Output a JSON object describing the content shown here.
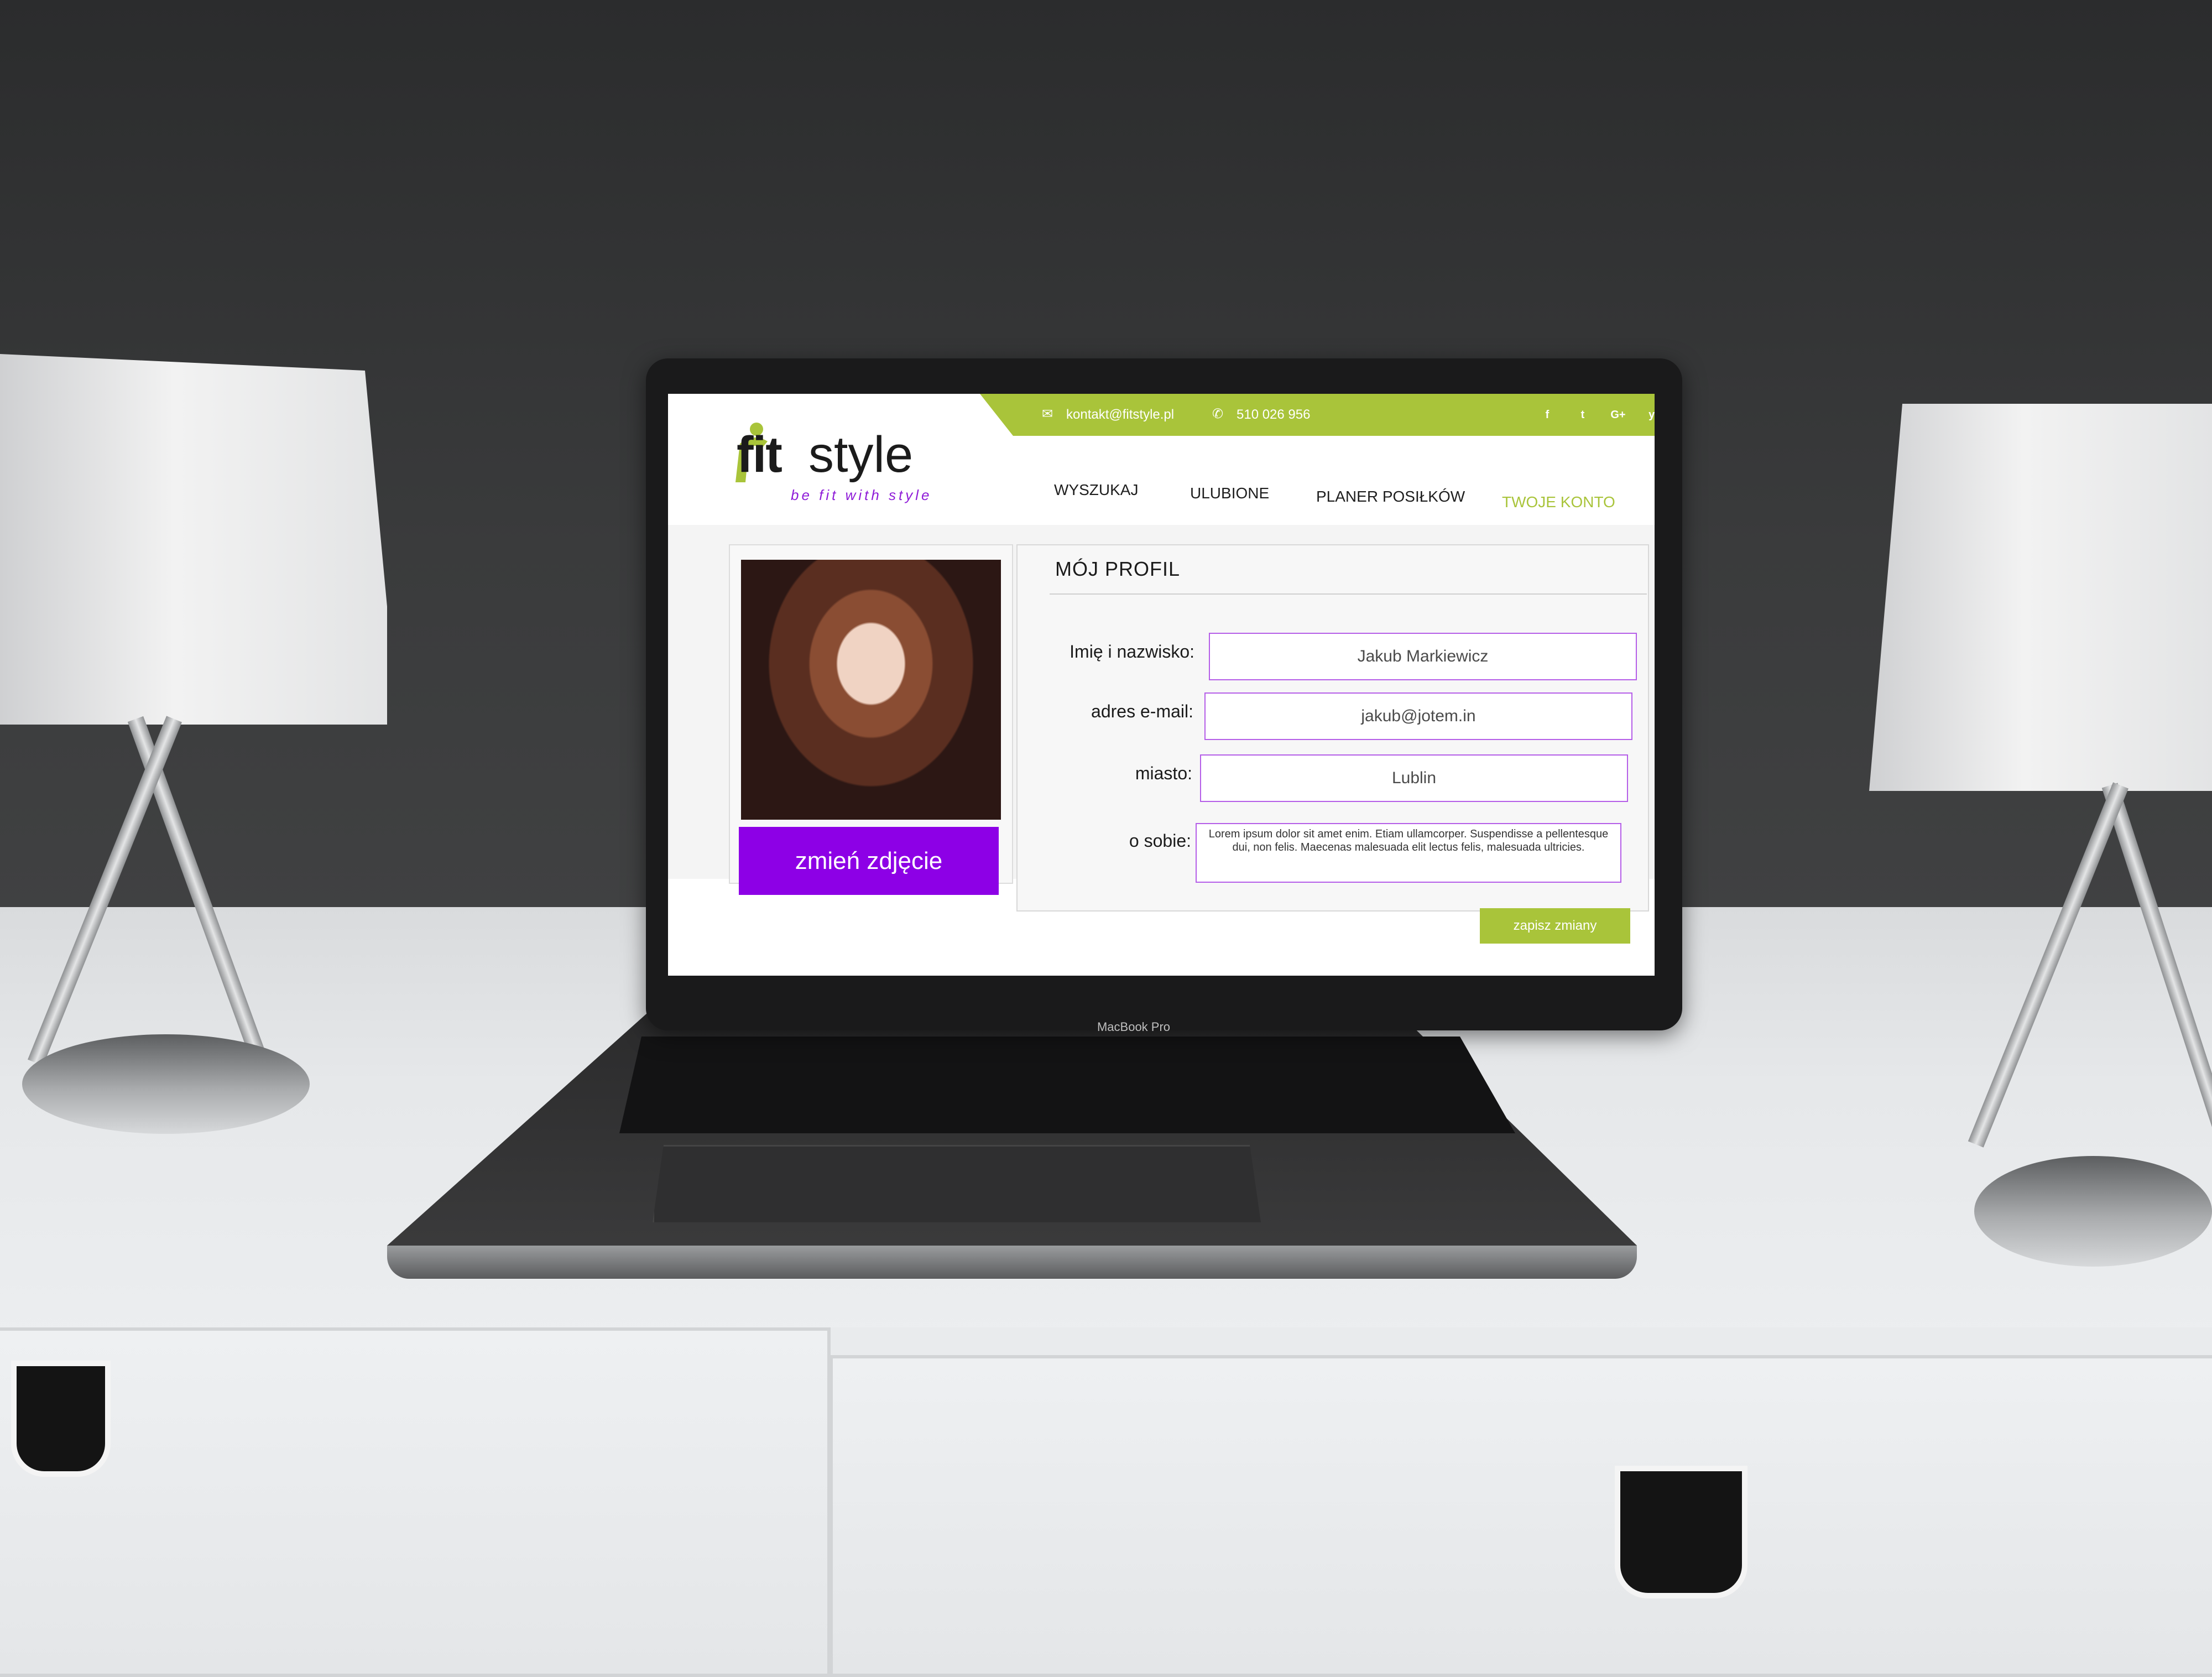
{
  "laptop": {
    "model_label": "MacBook Pro"
  },
  "site": {
    "logo": {
      "fit": "fit",
      "style": "style",
      "tagline": "be fit with style"
    },
    "topbar": {
      "email": "kontakt@fitstyle.pl",
      "phone": "510 026 956",
      "social": [
        "f",
        "t",
        "G+",
        "yt"
      ]
    },
    "nav": {
      "items": [
        {
          "label": "WYSZUKAJ",
          "active": false
        },
        {
          "label": "ULUBIONE",
          "active": false
        },
        {
          "label": "PLANER POSIŁKÓW",
          "active": false
        },
        {
          "label": "TWOJE KONTO",
          "active": true
        }
      ]
    },
    "profile": {
      "title": "MÓJ PROFIL",
      "change_photo_label": "zmień zdjęcie",
      "fields": [
        {
          "label": "Imię i nazwisko:",
          "value": "Jakub Markiewicz"
        },
        {
          "label": "adres e-mail:",
          "value": "jakub@jotem.in"
        },
        {
          "label": "miasto:",
          "value": "Lublin"
        },
        {
          "label": "o sobie:",
          "value": "Lorem ipsum dolor sit amet enim. Etiam ullamcorper. Suspendisse a pellentesque dui, non felis. Maecenas malesuada elit lectus felis, malesuada ultricies."
        }
      ],
      "save_label": "zapisz zmiany"
    },
    "colors": {
      "accent_green": "#a9c43a",
      "accent_purple": "#8d00e6"
    }
  }
}
